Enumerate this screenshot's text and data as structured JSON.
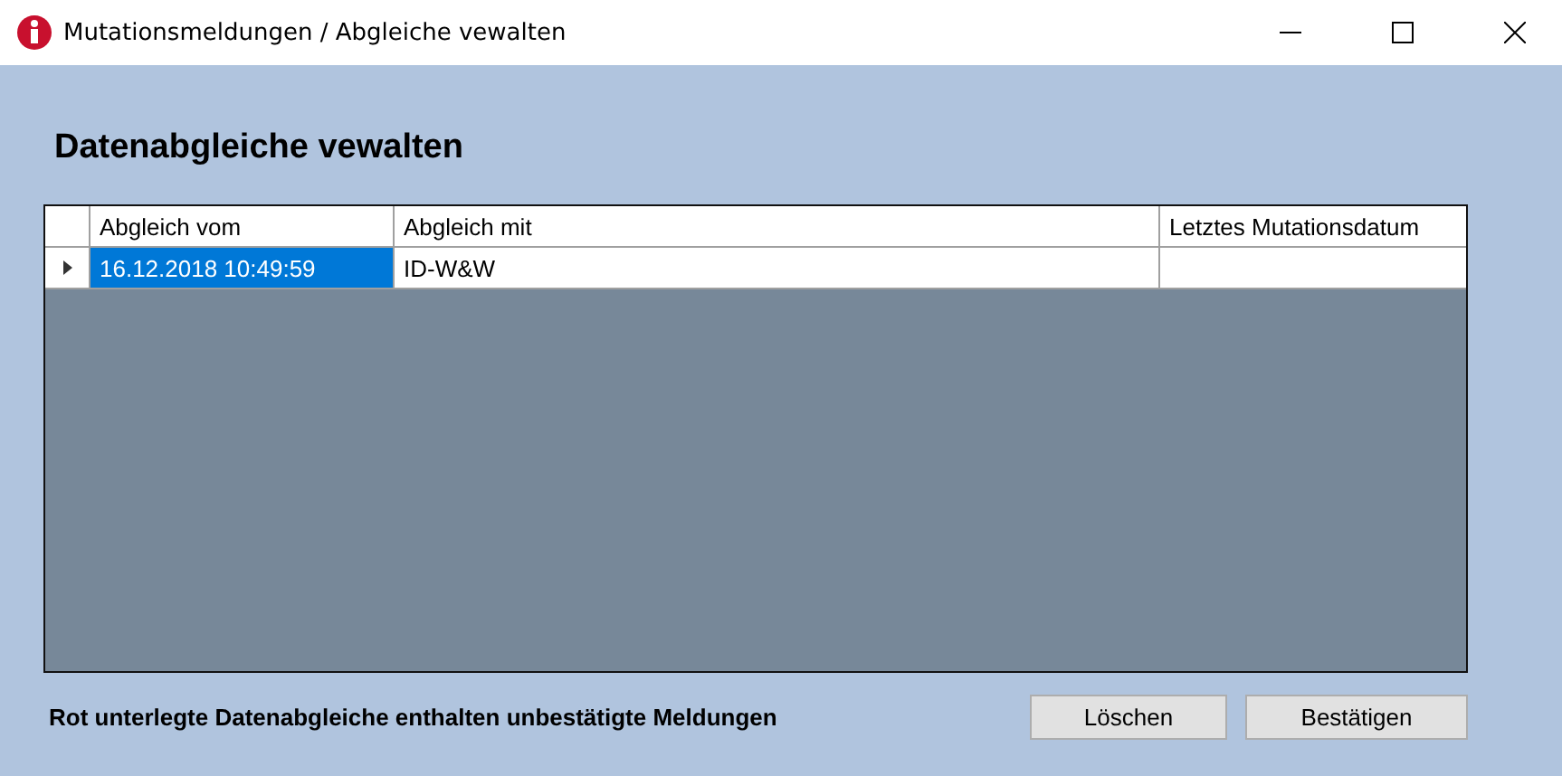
{
  "window": {
    "title": "Mutationsmeldungen / Abgleiche vewalten"
  },
  "heading": "Datenabgleiche vewalten",
  "table": {
    "columns": [
      "Abgleich vom",
      "Abgleich mit",
      "Letztes Mutationsdatum"
    ],
    "rows": [
      {
        "cells": [
          "16.12.2018 10:49:59",
          "ID-W&W"
        ],
        "selected": true
      }
    ]
  },
  "note": "Rot unterlegte Datenabgleiche enthalten unbestätigte Meldungen",
  "buttons": [
    "Löschen",
    "Bestätigen"
  ]
}
